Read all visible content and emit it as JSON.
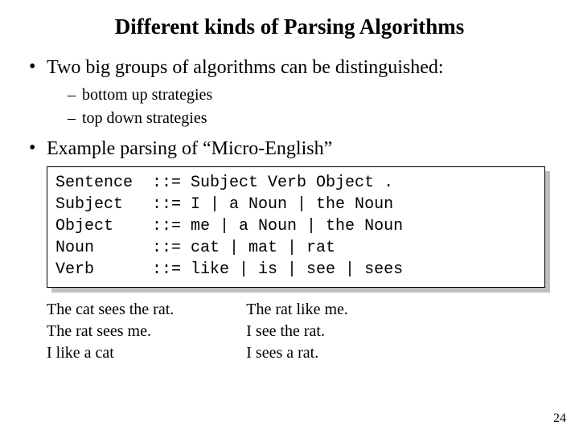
{
  "title": "Different kinds of Parsing Algorithms",
  "bullets": {
    "b1": "Two big groups of algorithms can be distinguished:",
    "sub1": "bottom up strategies",
    "sub2": "top down strategies",
    "b2": "Example parsing of  “Micro-English”"
  },
  "grammar": "Sentence  ::= Subject Verb Object .\nSubject   ::= I | a Noun | the Noun\nObject    ::= me | a Noun | the Noun\nNoun      ::= cat | mat | rat\nVerb      ::= like | is | see | sees",
  "examples": {
    "left": "The cat sees the rat.\nThe rat sees me.\nI like a cat",
    "right": "The rat like me.\nI see the rat.\nI sees a rat."
  },
  "page_number": "24"
}
